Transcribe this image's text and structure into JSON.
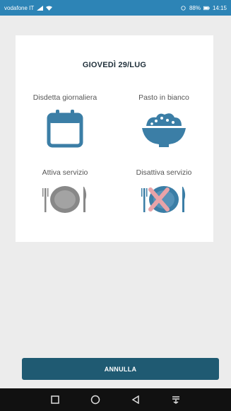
{
  "status_bar": {
    "carrier": "vodafone IT",
    "right_text": "88%",
    "time": "14:15"
  },
  "card": {
    "date_title": "GIOVEDÌ 29/LUG",
    "options": [
      {
        "label": "Disdetta giornaliera",
        "icon": "calendar-icon"
      },
      {
        "label": "Pasto in bianco",
        "icon": "rice-bowl-icon"
      },
      {
        "label": "Attiva servizio",
        "icon": "plate-cutlery-icon"
      },
      {
        "label": "Disattiva servizio",
        "icon": "plate-cutlery-crossed-icon"
      }
    ]
  },
  "footer": {
    "cancel_label": "ANNULLA"
  },
  "nav_bar": {
    "buttons": [
      "recent-apps-icon",
      "home-icon",
      "back-icon",
      "notifications-icon"
    ]
  },
  "colors": {
    "status_bar": "#2d84b6",
    "icon_blue": "#3b7ea6",
    "button": "#1f5a72",
    "plate_gray": "#888888",
    "cross_red": "#e8a3a8"
  }
}
